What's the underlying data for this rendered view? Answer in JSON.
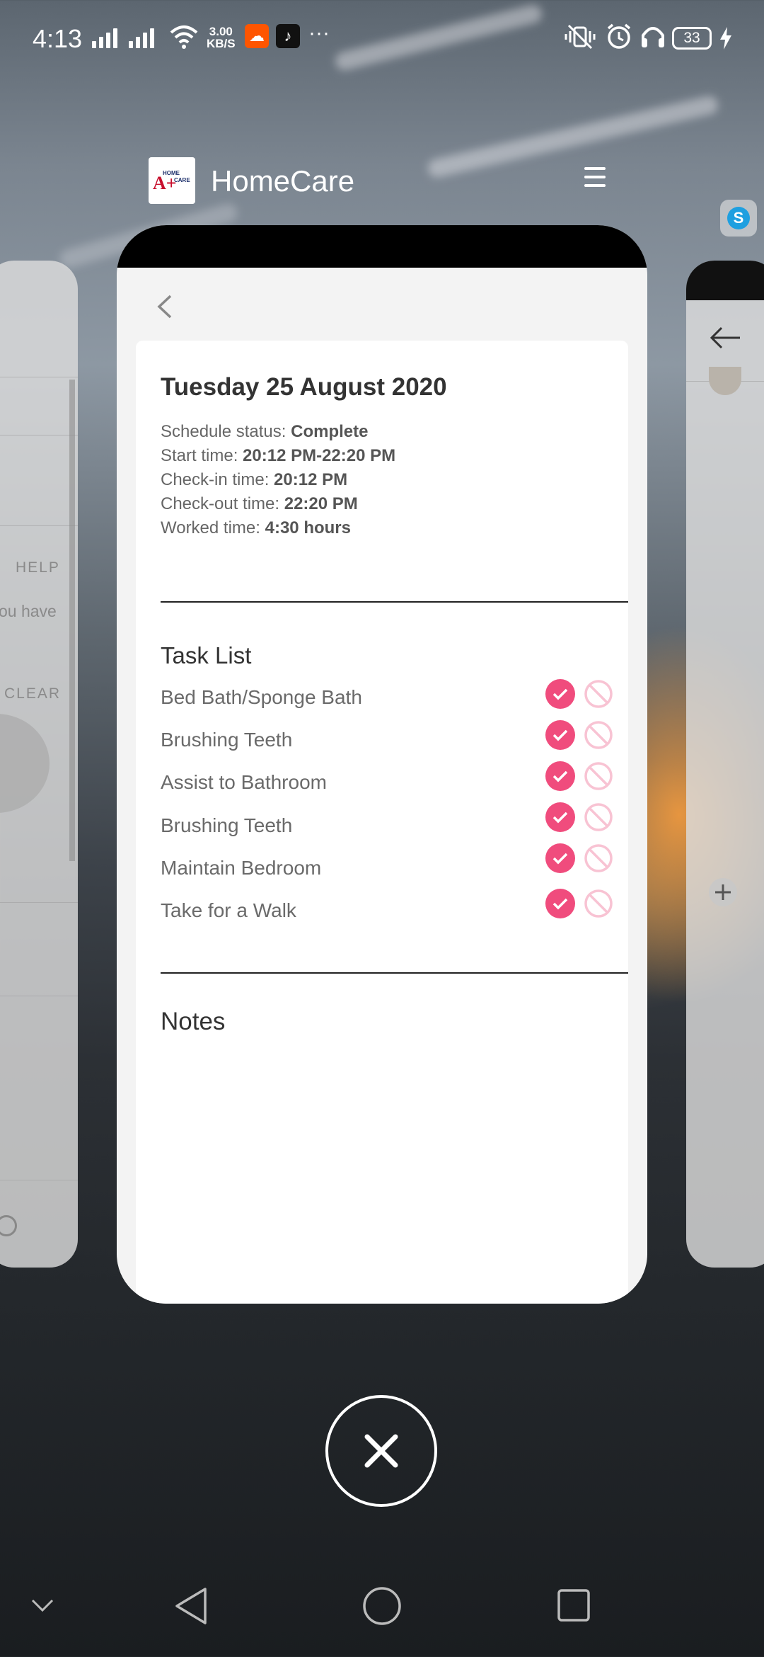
{
  "status_bar": {
    "time": "4:13",
    "net_speed_value": "3.00",
    "net_speed_unit": "KB/S",
    "battery": "33"
  },
  "app": {
    "title": "HomeCare",
    "logo_line1": "HOME",
    "logo_line2": "CARE"
  },
  "skype_icon_letter": "S",
  "left_card": {
    "help": "HELP",
    "text": "ou have",
    "clear": "CLEAR"
  },
  "schedule": {
    "date_title": "Tuesday 25 August 2020",
    "status_label": "Schedule status: ",
    "status_value": "Complete",
    "start_label": "Start time: ",
    "start_value": "20:12 PM-22:20 PM",
    "checkin_label": "Check-in time: ",
    "checkin_value": "20:12 PM",
    "checkout_label": "Check-out time: ",
    "checkout_value": "22:20 PM",
    "worked_label": "Worked time: ",
    "worked_value": "4:30 hours"
  },
  "task_list": {
    "title": "Task List",
    "tasks": [
      {
        "name": "Bed Bath/Sponge Bath",
        "done": true
      },
      {
        "name": "Brushing Teeth",
        "done": true
      },
      {
        "name": "Assist to Bathroom",
        "done": true
      },
      {
        "name": "Brushing Teeth",
        "done": true
      },
      {
        "name": "Maintain Bedroom",
        "done": true
      },
      {
        "name": "Take for a Walk",
        "done": true
      }
    ]
  },
  "notes": {
    "title": "Notes"
  },
  "colors": {
    "accent": "#f04c7d",
    "accent_light": "#f8c3d3"
  }
}
